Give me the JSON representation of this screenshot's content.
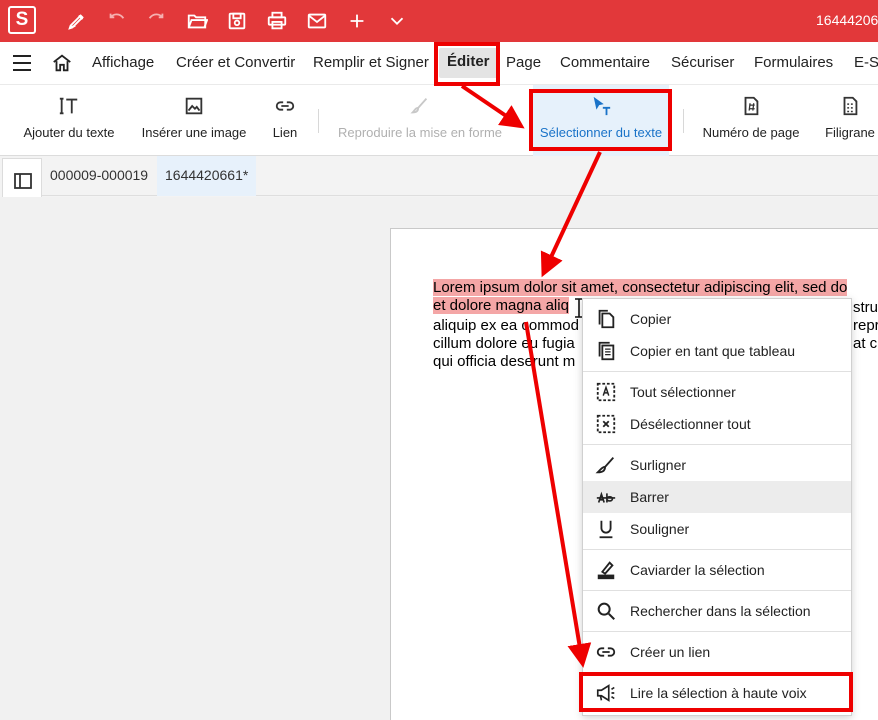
{
  "titlebar": {
    "logo": "S",
    "title": "16444206",
    "icons": [
      "sign-pen-icon",
      "undo-icon",
      "redo-icon",
      "open-folder-icon",
      "save-icon",
      "print-icon",
      "mail-icon",
      "plus-icon",
      "chevron-down-icon"
    ]
  },
  "menu": {
    "items": [
      "Affichage",
      "Créer et Convertir",
      "Remplir et Signer",
      "Éditer",
      "Page",
      "Commentaire",
      "Sécuriser",
      "Formulaires",
      "E-Si"
    ]
  },
  "ribbon": {
    "buttons": [
      {
        "label": "Ajouter du texte",
        "icon": "add-text-icon"
      },
      {
        "label": "Insérer une image",
        "icon": "image-icon"
      },
      {
        "label": "Lien",
        "icon": "link-icon"
      },
      {
        "label": "Reproduire la mise en forme",
        "icon": "format-painter-icon"
      },
      {
        "label": "Sélectionner du texte",
        "icon": "select-text-icon"
      },
      {
        "label": "Numéro de page",
        "icon": "page-number-icon"
      },
      {
        "label": "Filigrane",
        "icon": "watermark-icon"
      }
    ]
  },
  "tabs": [
    "000009-000019",
    "1644420661*"
  ],
  "document": {
    "lines": [
      "et dolore magna aliq",
      "aliquip ex ea commod",
      "cillum dolore eu fugia",
      "qui officia deserunt m"
    ],
    "highlight_line1": "Lorem ipsum dolor sit amet, consectetur adipiscing elit, sed do",
    "highlight_line2": "et dolore magna aliq",
    "right_fragments": [
      "struc",
      "repr",
      "at cu"
    ]
  },
  "context_menu": {
    "items": [
      {
        "label": "Copier",
        "icon": "copy-icon"
      },
      {
        "label": "Copier en tant que tableau",
        "icon": "copy-table-icon"
      },
      {
        "label": "Tout sélectionner",
        "icon": "select-all-icon"
      },
      {
        "label": "Désélectionner tout",
        "icon": "deselect-all-icon"
      },
      {
        "label": "Surligner",
        "icon": "highlighter-icon"
      },
      {
        "label": "Barrer",
        "icon": "strikethrough-icon"
      },
      {
        "label": "Souligner",
        "icon": "underline-icon"
      },
      {
        "label": "Caviarder la sélection",
        "icon": "redact-icon"
      },
      {
        "label": "Rechercher dans la sélection",
        "icon": "search-icon"
      },
      {
        "label": "Créer un lien",
        "icon": "link-icon"
      },
      {
        "label": "Lire la sélection à haute voix",
        "icon": "megaphone-icon"
      }
    ]
  },
  "colors": {
    "titlebar": "#e2383a",
    "annotation_red": "#ee0000",
    "selection_highlight": "#f4a6a6",
    "selected_tool": "#1a73c8"
  }
}
